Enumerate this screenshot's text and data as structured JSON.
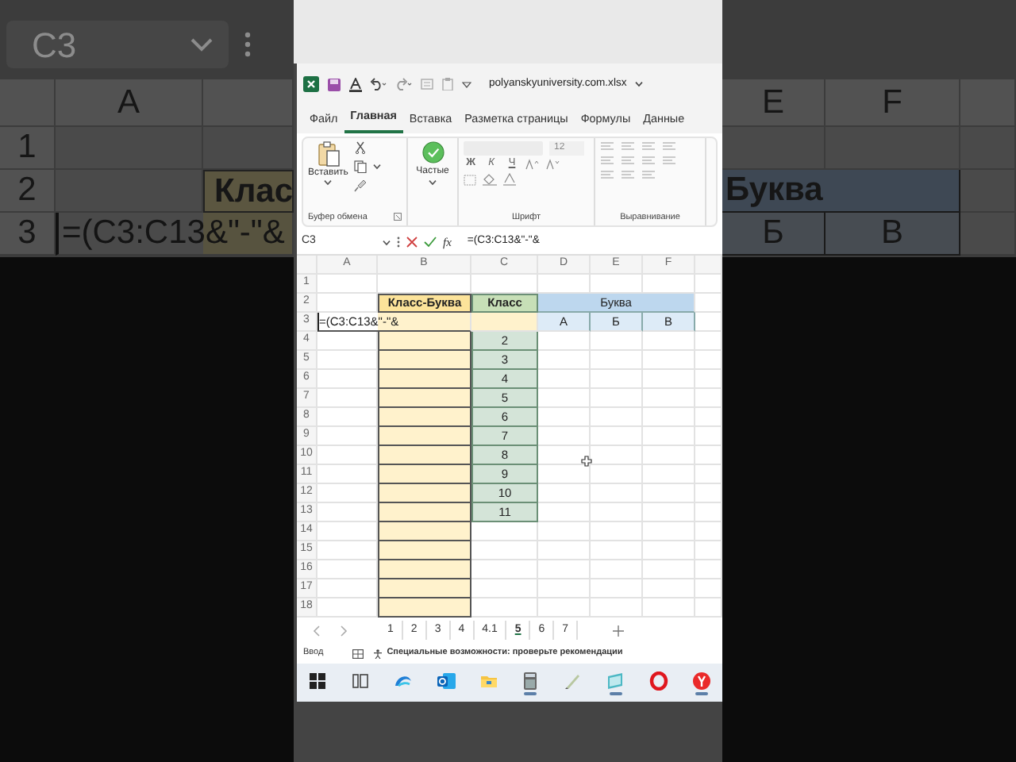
{
  "backdrop_left": {
    "name_box": "C3",
    "column": "A",
    "row_numbers": [
      "1",
      "2",
      "3"
    ],
    "header_cell": "Клас",
    "editing_text": "=(C3:C13&\"-\"&"
  },
  "backdrop_right": {
    "columns": [
      "E",
      "F"
    ],
    "header_cell": "Буква",
    "letters": [
      "Б",
      "В"
    ]
  },
  "window": {
    "title": "polyanskyuniversity.com.xlsx"
  },
  "menu_tabs": [
    {
      "label": "Файл",
      "selected": false
    },
    {
      "label": "Главная",
      "selected": true
    },
    {
      "label": "Вставка",
      "selected": false
    },
    {
      "label": "Разметка страницы",
      "selected": false
    },
    {
      "label": "Формулы",
      "selected": false
    },
    {
      "label": "Данные",
      "selected": false
    }
  ],
  "ribbon": {
    "clipboard": {
      "paste": "Вставить",
      "label": "Буфер обмена"
    },
    "styles": {
      "button": "Частые"
    },
    "font": {
      "size": "12",
      "disabled": true,
      "format_buttons": [
        "Ж",
        "К",
        "Ч"
      ],
      "label": "Шрифт"
    },
    "alignment": {
      "label": "Выравнивание"
    }
  },
  "formula_bar": {
    "name_box": "C3",
    "fx": "fx",
    "formula": "=(C3:C13&\"-\"&"
  },
  "sheet": {
    "columns": [
      "A",
      "B",
      "C",
      "D",
      "E",
      "F"
    ],
    "row_numbers": [
      "1",
      "2",
      "3",
      "4",
      "5",
      "6",
      "7",
      "8",
      "9",
      "10",
      "11",
      "12",
      "13",
      "14",
      "15",
      "16",
      "17",
      "18"
    ],
    "headers": [
      "Класс-Буква",
      "Класс",
      "Буква"
    ],
    "letters": [
      "А",
      "Б",
      "В"
    ],
    "editing_text": "=(C3:C13&\"-\"&",
    "classes": [
      "2",
      "3",
      "4",
      "5",
      "6",
      "7",
      "8",
      "9",
      "10",
      "11"
    ]
  },
  "sheet_tabs": [
    {
      "label": "1",
      "selected": false
    },
    {
      "label": "2",
      "selected": false
    },
    {
      "label": "3",
      "selected": false
    },
    {
      "label": "4",
      "selected": false
    },
    {
      "label": "4.1",
      "selected": false
    },
    {
      "label": "5",
      "selected": true
    },
    {
      "label": "6",
      "selected": false
    },
    {
      "label": "7",
      "selected": false
    }
  ],
  "status_bar": {
    "mode": "Ввод",
    "accessibility": "Специальные возможности: проверьте рекомендации"
  },
  "taskbar": [
    {
      "running": false
    },
    {
      "running": false
    },
    {
      "running": false
    },
    {
      "running": false
    },
    {
      "running": false
    },
    {
      "running": true
    },
    {
      "running": false
    },
    {
      "running": true
    },
    {
      "running": false
    },
    {
      "running": true
    }
  ]
}
